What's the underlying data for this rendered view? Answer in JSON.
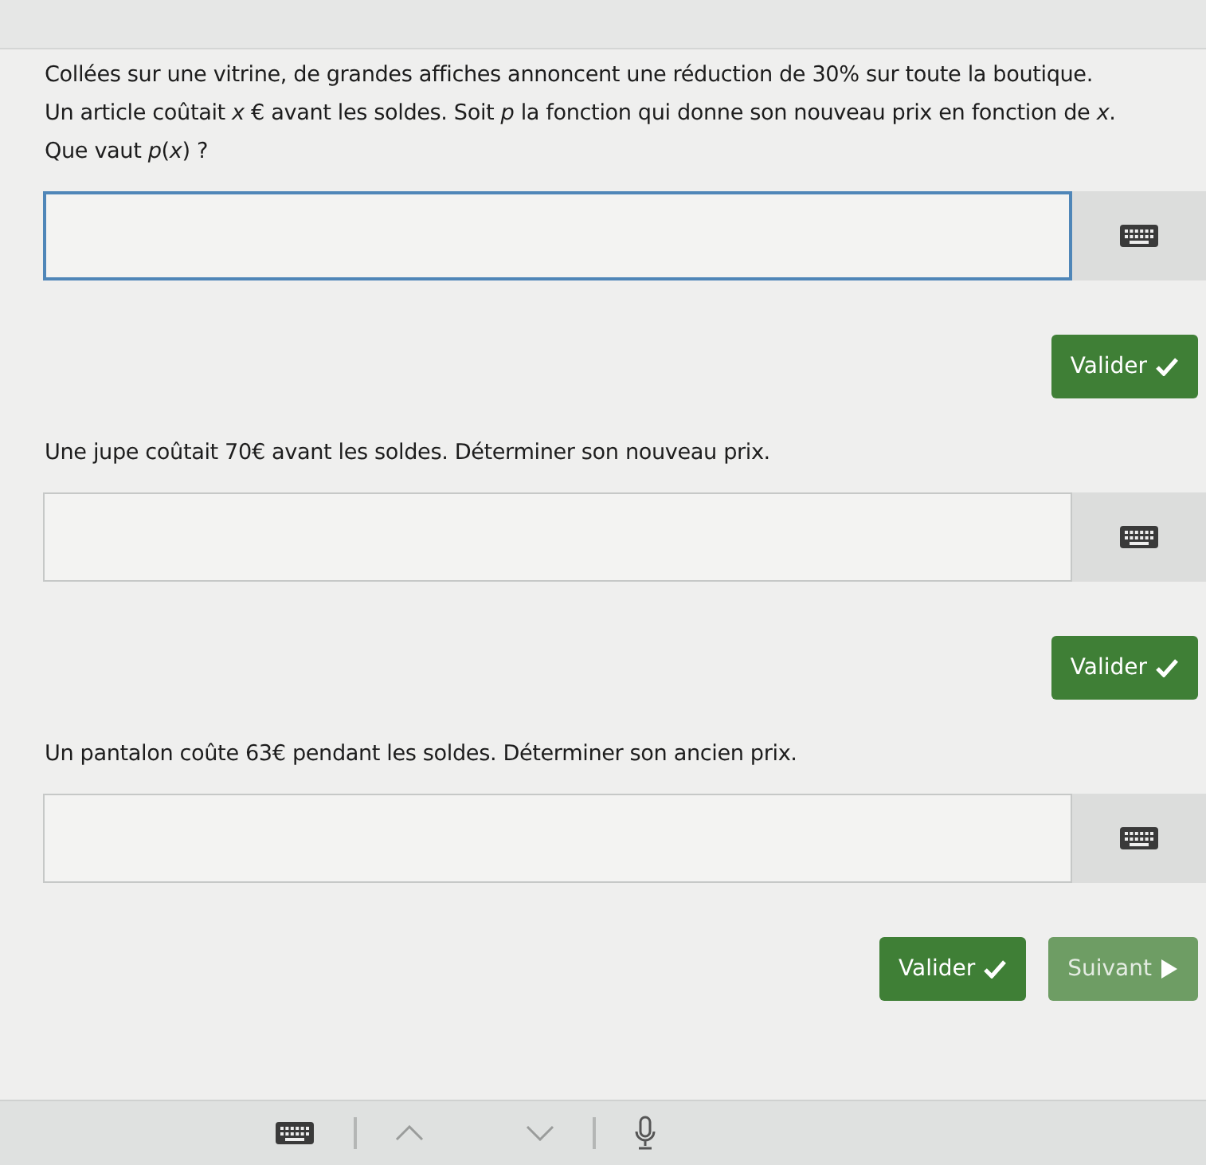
{
  "questions": [
    {
      "lines": [
        "Collées sur une vitrine, de grandes affiches annoncent une réduction de 30% sur toute la boutique.",
        "Un article coûtait *x* € avant les soldes. Soit *p* la fonction qui donne son nouveau prix en fonction de *x*.",
        "Que vaut *p*(*x*) ?"
      ],
      "answer": {
        "focused": true
      },
      "buttons": [
        {
          "kind": "validate",
          "label": "Valider",
          "disabled": false
        }
      ]
    },
    {
      "lines": [
        "Une jupe coûtait 70€ avant les soldes. Déterminer son nouveau prix."
      ],
      "answer": {
        "focused": false
      },
      "buttons": [
        {
          "kind": "validate",
          "label": "Valider",
          "disabled": false
        }
      ]
    },
    {
      "lines": [
        "Un pantalon coûte 63€ pendant les soldes. Déterminer son ancien prix."
      ],
      "answer": {
        "focused": false
      },
      "buttons": [
        {
          "kind": "validate",
          "label": "Valider",
          "disabled": false
        },
        {
          "kind": "next",
          "label": "Suivant",
          "disabled": true
        }
      ]
    }
  ]
}
